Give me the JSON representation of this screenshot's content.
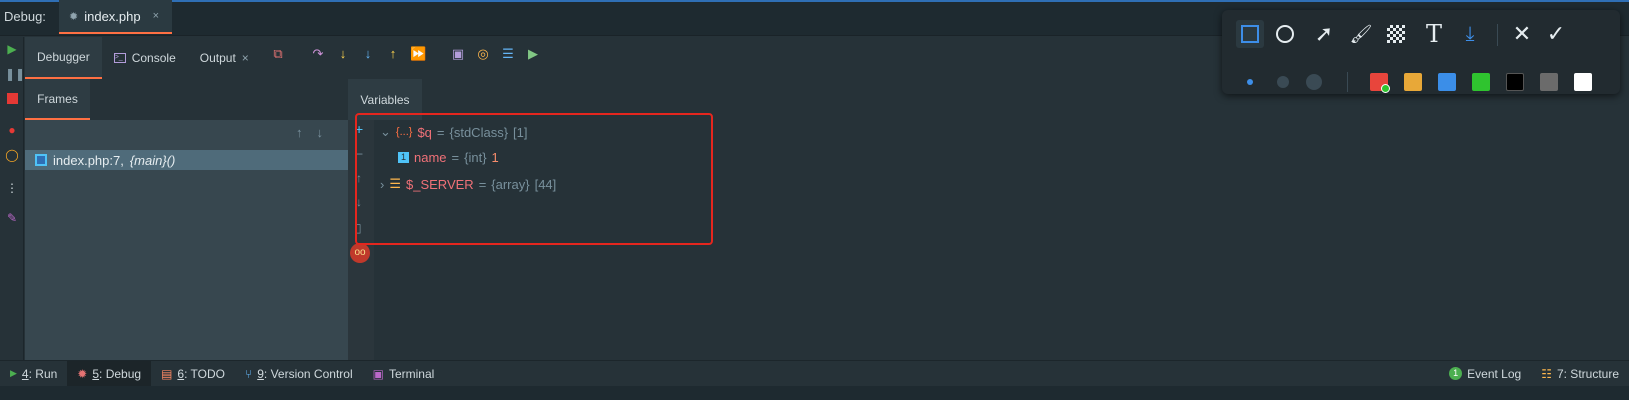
{
  "header": {
    "debug_label": "Debug:",
    "file_tab": "index.php",
    "close_glyph": "×"
  },
  "debugger_tabs": [
    {
      "label": "Debugger",
      "active": true
    },
    {
      "label": "Console",
      "icon": "console-icon"
    },
    {
      "label": "Output",
      "close": "×"
    }
  ],
  "frames": {
    "tab_label": "Frames",
    "items": [
      {
        "file": "index.php:7,",
        "func": "{main}()"
      }
    ]
  },
  "variables": {
    "tab_label": "Variables",
    "rows": [
      {
        "expand": "v",
        "icon": "{...}",
        "name": "$q",
        "eq": "=",
        "type": "{stdClass}",
        "count": "[1]"
      },
      {
        "icon": "1",
        "name": "name",
        "eq": "=",
        "type": "{int}",
        "value": "1"
      },
      {
        "expand": ">",
        "icon": "list-icon",
        "name": "$_SERVER",
        "eq": "=",
        "type": "{array}",
        "count": "[44]"
      }
    ]
  },
  "bottom_tabs": [
    {
      "num": "4",
      "label": ": Run",
      "icon": "run-icon"
    },
    {
      "num": "5",
      "label": ": Debug",
      "icon": "debug-icon",
      "active": true
    },
    {
      "num": "6",
      "label": ": TODO",
      "icon": "todo-icon"
    },
    {
      "num": "9",
      "label": ": Version Control",
      "icon": "vcs-icon"
    },
    {
      "label": "Terminal",
      "icon": "terminal-icon"
    }
  ],
  "bottom_right": [
    {
      "label": "Event Log",
      "badge": "1"
    },
    {
      "label": "7: Structure",
      "icon": "structure-icon"
    }
  ],
  "annotation_toolbar": {
    "colors": [
      "#e8453c",
      "#e8a838",
      "#3b8ee8",
      "#2fc42f",
      "#000000",
      "#6b6b6b",
      "#ffffff"
    ]
  }
}
